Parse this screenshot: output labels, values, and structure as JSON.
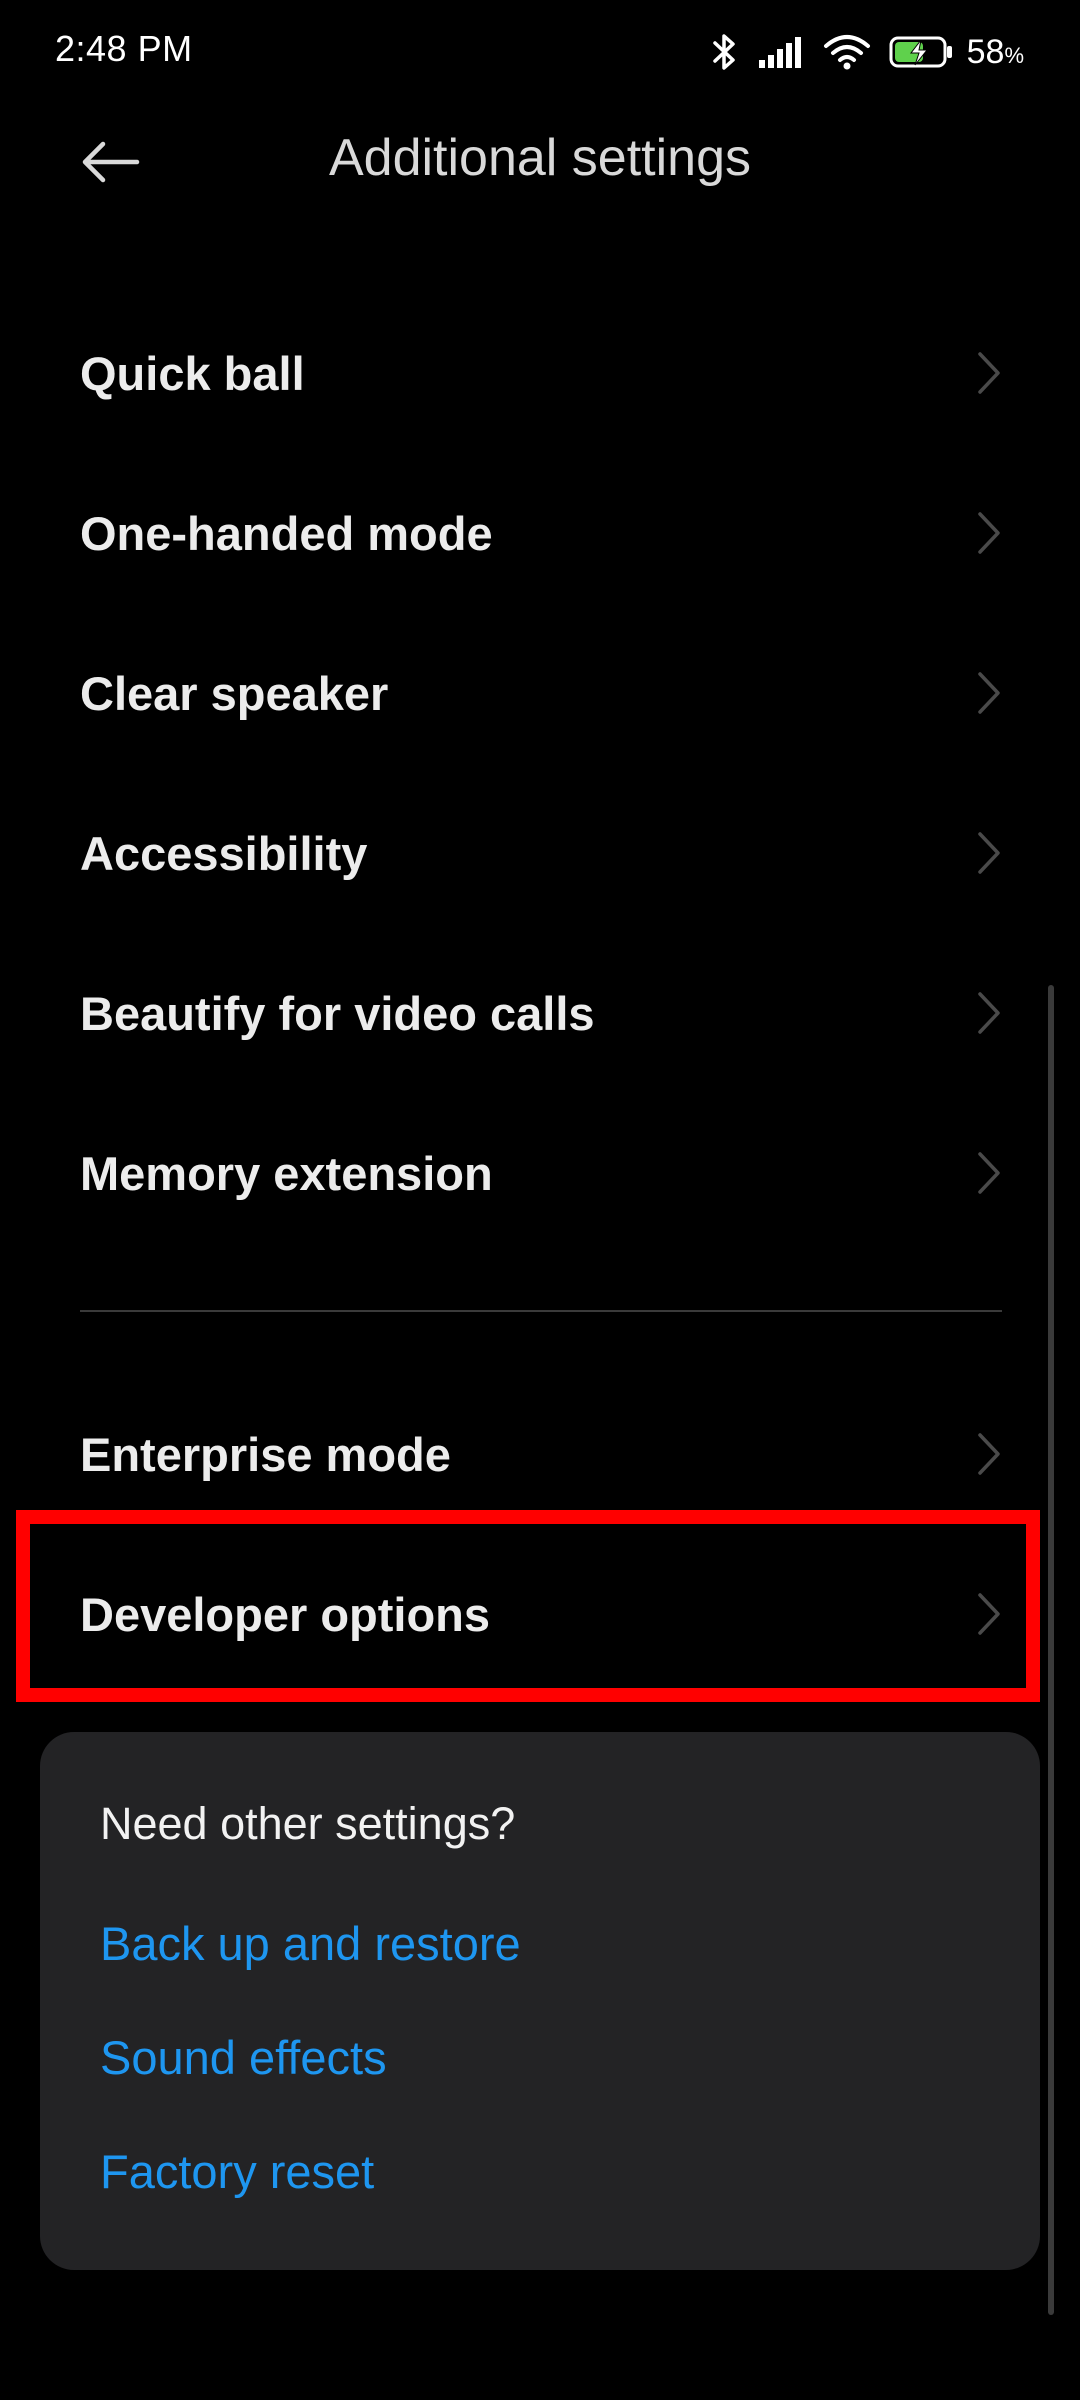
{
  "status_bar": {
    "time": "2:48 PM",
    "battery_percent": "58",
    "battery_unit": "%",
    "icons": [
      "bluetooth-icon",
      "signal-icon",
      "wifi-icon",
      "battery-charging-icon"
    ]
  },
  "header": {
    "title": "Additional settings",
    "back_icon": "back-arrow-icon"
  },
  "settings": {
    "group1": [
      {
        "label": "Quick ball"
      },
      {
        "label": "One-handed mode"
      },
      {
        "label": "Clear speaker"
      },
      {
        "label": "Accessibility"
      },
      {
        "label": "Beautify for video calls"
      },
      {
        "label": "Memory extension"
      }
    ],
    "group2": [
      {
        "label": "Enterprise mode"
      },
      {
        "label": "Developer options"
      }
    ]
  },
  "other_settings": {
    "title": "Need other settings?",
    "links": [
      {
        "label": "Back up and restore"
      },
      {
        "label": "Sound effects"
      },
      {
        "label": "Factory reset"
      }
    ]
  },
  "colors": {
    "background": "#000000",
    "link": "#1e96f0",
    "highlight": "#ff0000",
    "card": "#232325"
  }
}
